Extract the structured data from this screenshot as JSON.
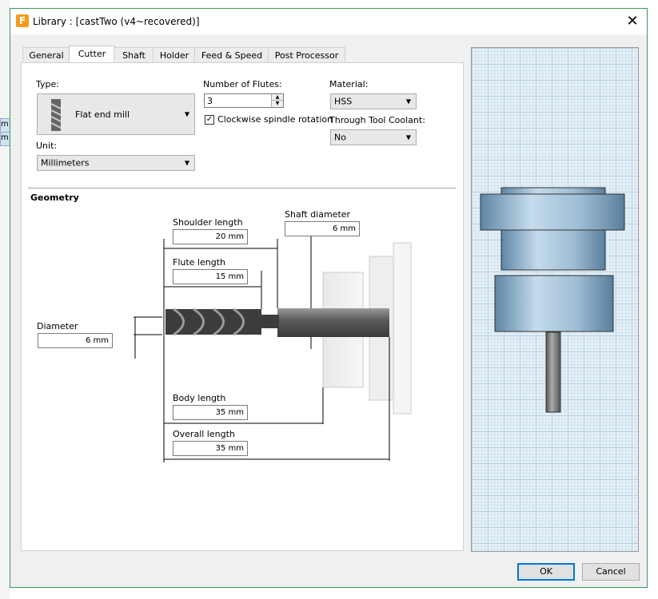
{
  "window": {
    "title": "Library :  [castTwo (v4~recovered)]",
    "app_icon": "F",
    "close": "✕"
  },
  "background": {
    "tab1": "m",
    "tab2": "m"
  },
  "tabs": [
    "General",
    "Cutter",
    "Shaft",
    "Holder",
    "Feed & Speed",
    "Post Processor"
  ],
  "cutter": {
    "type_label": "Type:",
    "type_value": "Flat end mill",
    "unit_label": "Unit:",
    "unit_value": "Millimeters",
    "flutes_label": "Number of Flutes:",
    "flutes_value": "3",
    "clockwise_label": "Clockwise spindle rotation",
    "clockwise_checked": true,
    "material_label": "Material:",
    "material_value": "HSS",
    "coolant_label": "Through Tool Coolant:",
    "coolant_value": "No"
  },
  "geometry": {
    "heading": "Geometry",
    "shoulder_length": {
      "label": "Shoulder length",
      "value": "20 mm"
    },
    "shaft_diameter": {
      "label": "Shaft diameter",
      "value": "6 mm"
    },
    "flute_length": {
      "label": "Flute length",
      "value": "15 mm"
    },
    "diameter": {
      "label": "Diameter",
      "value": "6 mm"
    },
    "body_length": {
      "label": "Body length",
      "value": "35 mm"
    },
    "overall_length": {
      "label": "Overall length",
      "value": "35 mm"
    }
  },
  "buttons": {
    "ok": "OK",
    "cancel": "Cancel"
  },
  "colors": {
    "accent": "#0078d7",
    "border": "#3b9a5a",
    "holder_blue": "#8fb4cf"
  }
}
